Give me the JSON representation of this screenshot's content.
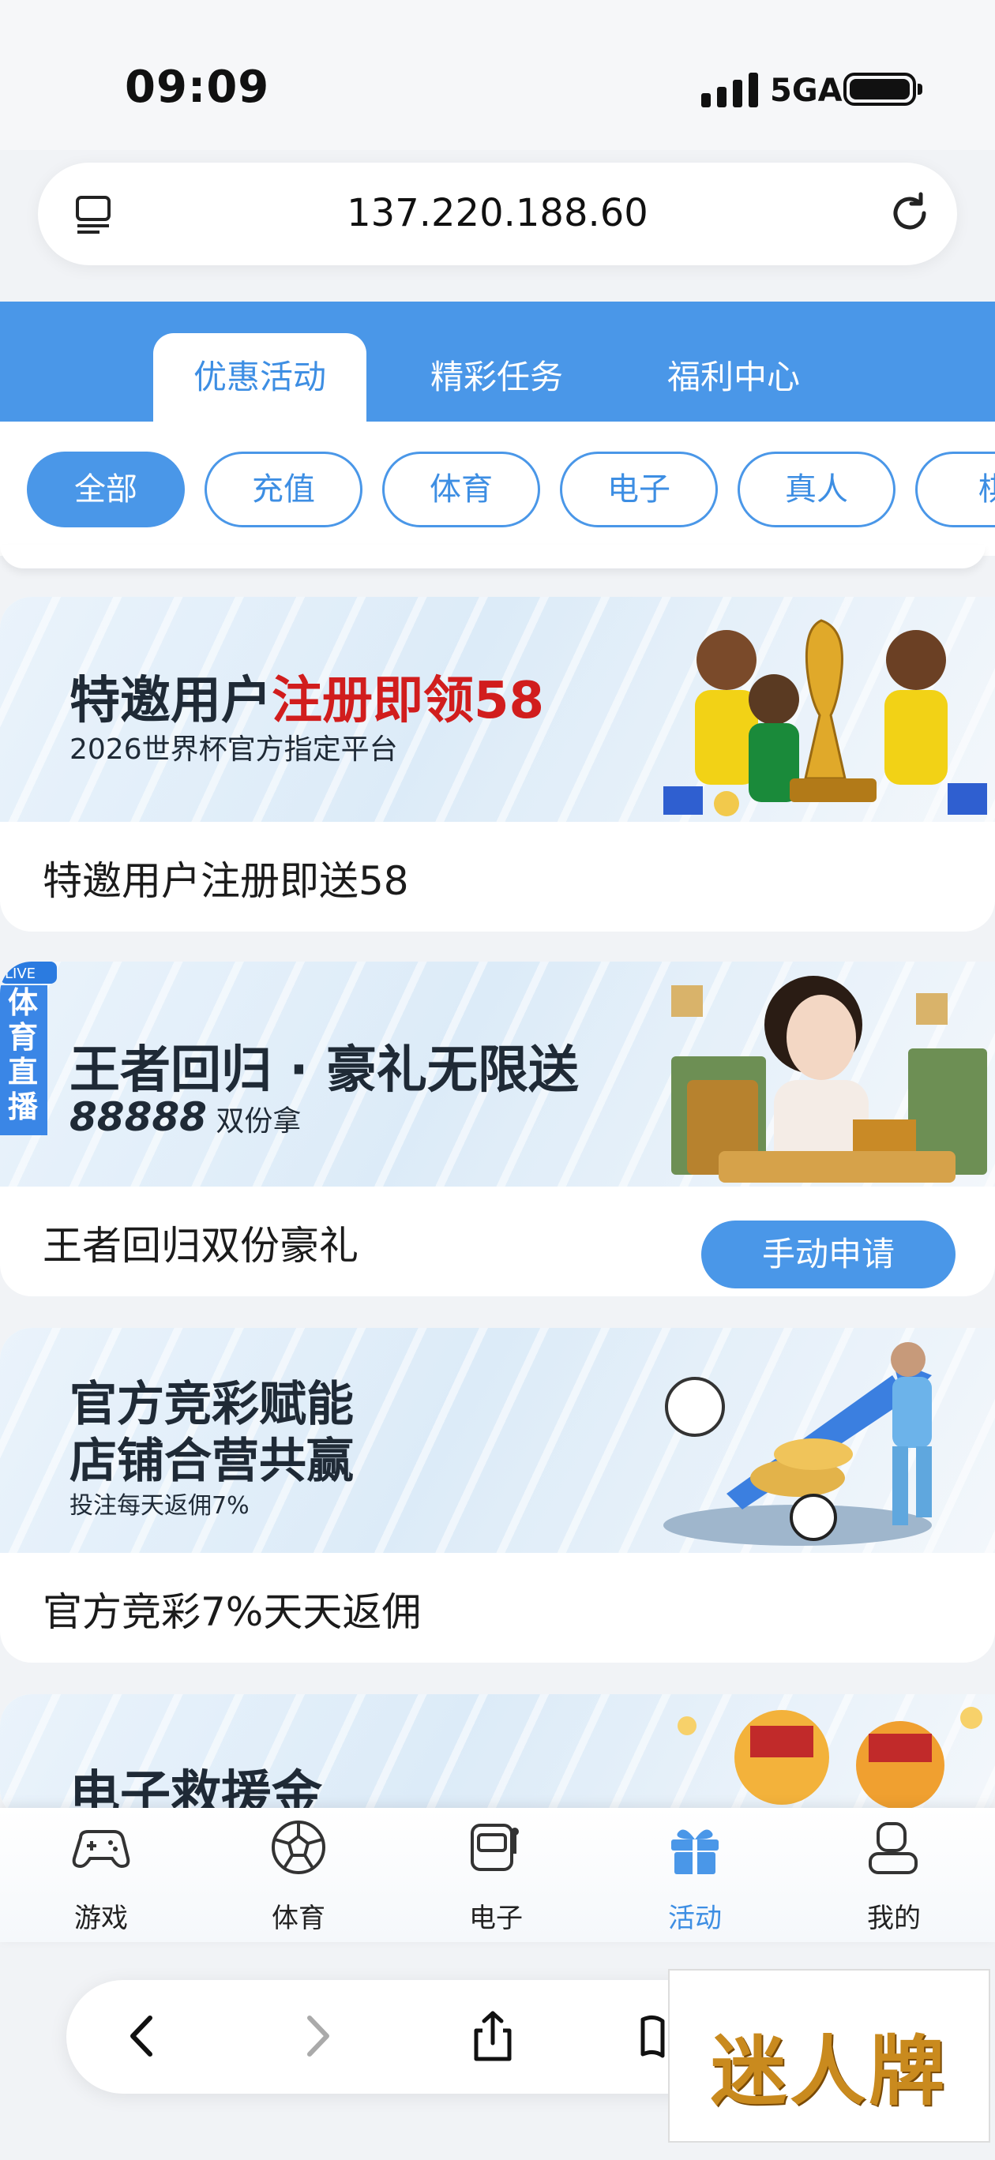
{
  "status_bar": {
    "time": "09:09",
    "network": "5GA"
  },
  "url_bar": {
    "url": "137.220.188.60"
  },
  "tabs": [
    {
      "label": "优惠活动",
      "active": true
    },
    {
      "label": "精彩任务",
      "active": false
    },
    {
      "label": "福利中心",
      "active": false
    }
  ],
  "chips": [
    {
      "label": "全部",
      "active": true
    },
    {
      "label": "充值"
    },
    {
      "label": "体育"
    },
    {
      "label": "电子"
    },
    {
      "label": "真人"
    },
    {
      "label": "棋"
    }
  ],
  "promos": [
    {
      "banner_title": "特邀用户",
      "banner_title_red": "注册即领58",
      "banner_sub": "2026世界杯官方指定平台",
      "text": "特邀用户注册即送58"
    },
    {
      "live_tag": "LIVE",
      "live_side": "体育直播",
      "banner_title": "王者回归 · 豪礼无限送",
      "banner_sub_big": "88888",
      "banner_sub": "双份拿",
      "text": "王者回归双份豪礼",
      "button": "手动申请"
    },
    {
      "banner_title": "官方竞彩赋能",
      "banner_title2": "店铺合营共赢",
      "banner_sub": "投注每天返佣7%",
      "text": "官方竞彩7%天天返佣"
    },
    {
      "banner_title": "电子救援金"
    }
  ],
  "bottom_nav": [
    {
      "label": "游戏",
      "icon": "gamepad-icon"
    },
    {
      "label": "体育",
      "icon": "soccer-ball-icon"
    },
    {
      "label": "电子",
      "icon": "slot-machine-icon"
    },
    {
      "label": "活动",
      "icon": "gift-icon",
      "active": true
    },
    {
      "label": "我的",
      "icon": "user-icon"
    }
  ],
  "watermark": "迷人牌",
  "colors": {
    "accent": "#4a97e8",
    "red": "#d11d1d"
  }
}
